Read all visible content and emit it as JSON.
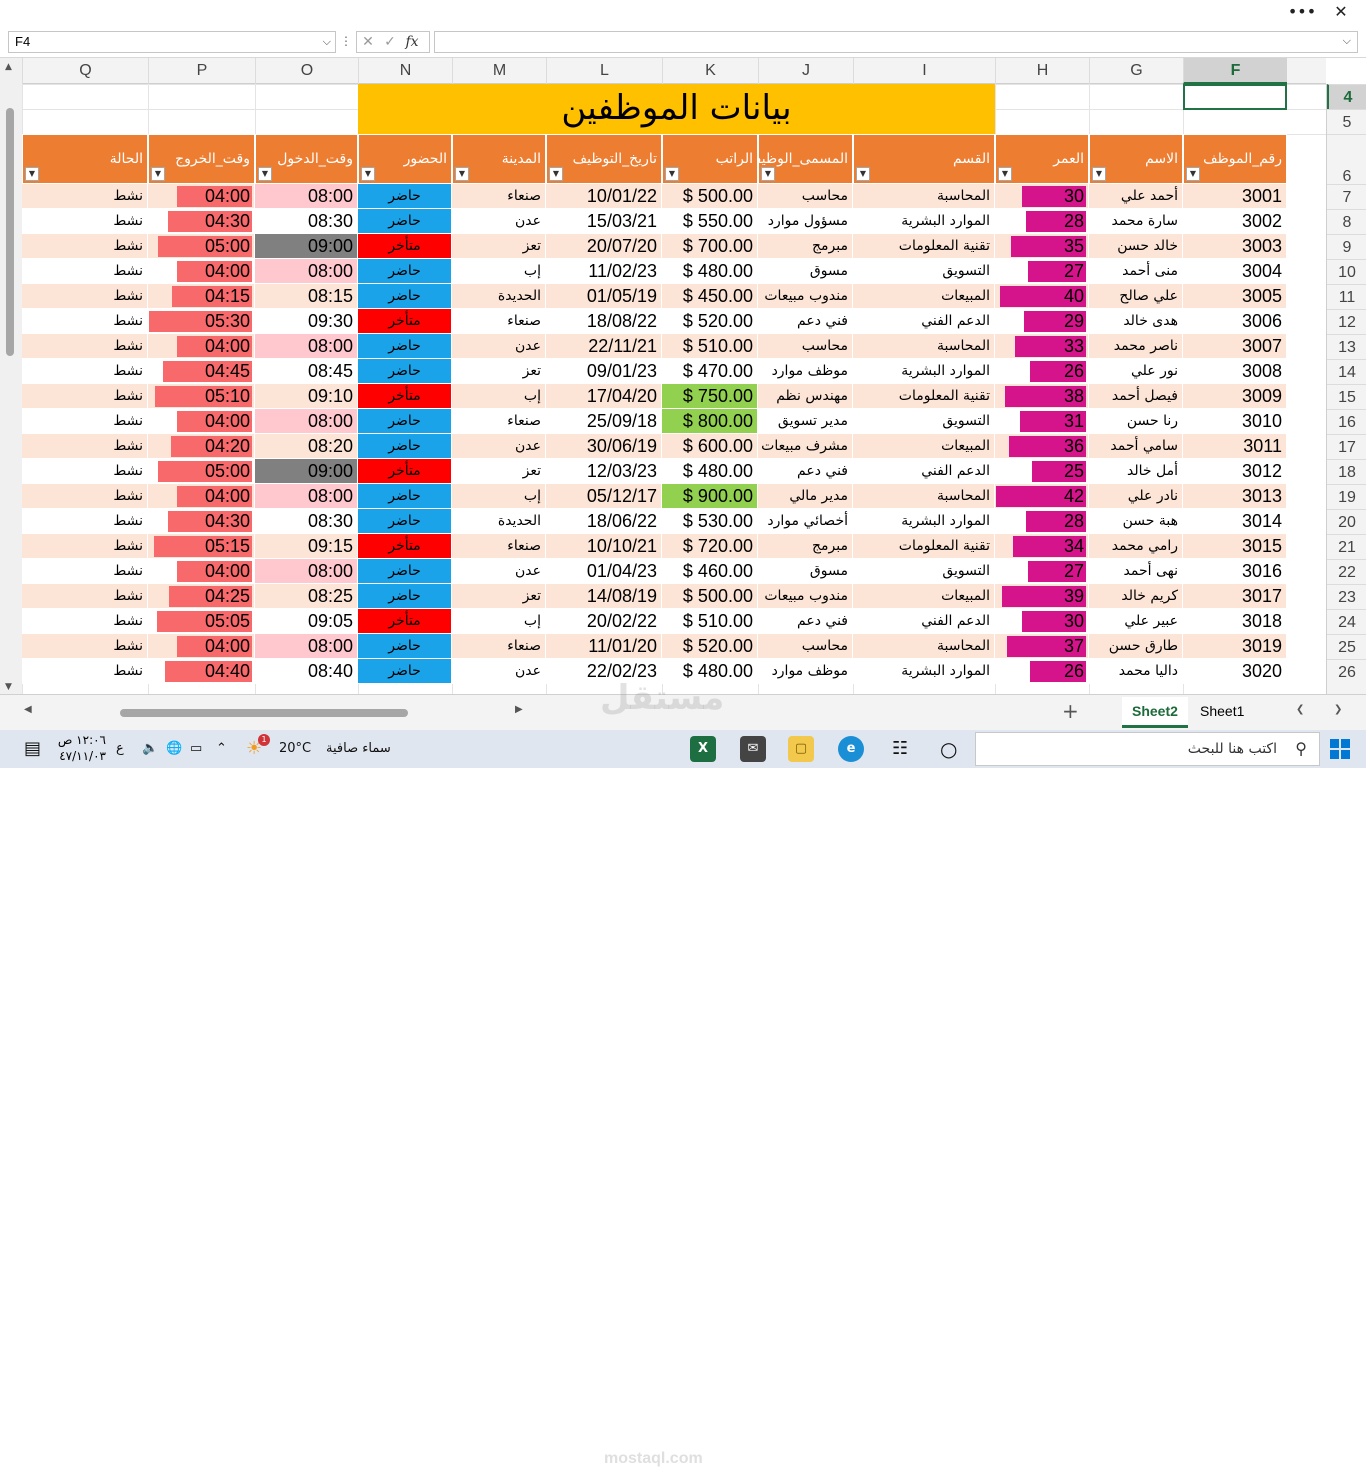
{
  "window": {
    "more_label": "•••",
    "close_label": "✕"
  },
  "formula_bar": {
    "name_box": "F4",
    "cancel_glyph": "✕",
    "enter_glyph": "✓",
    "fx_label": "fx",
    "formula": ""
  },
  "columns": [
    "Q",
    "P",
    "O",
    "N",
    "M",
    "L",
    "K",
    "J",
    "I",
    "H",
    "G",
    "F"
  ],
  "selected_column": "F",
  "row_numbers": [
    "4",
    "5",
    "6",
    "7",
    "8",
    "9",
    "10",
    "11",
    "12",
    "13",
    "14",
    "15",
    "16",
    "17",
    "18",
    "19",
    "20",
    "21",
    "22",
    "23",
    "24",
    "25",
    "26"
  ],
  "selected_row": "4",
  "sheet_title": "بيانات الموظفين",
  "headers": {
    "F": "رقم_الموظف",
    "G": "الاسم",
    "H": "العمر",
    "I": "القسم",
    "J": "المسمى_الوظيفي",
    "K": "الراتب",
    "L": "تاريخ_التوظيف",
    "M": "المدينة",
    "N": "الحضور",
    "O": "وقت_الدخول",
    "P": "وقت_الخروج",
    "Q": "الحالة"
  },
  "rows": [
    {
      "id": "3001",
      "name": "أحمد علي",
      "age": 30,
      "dept": "المحاسبة",
      "title": "محاسب",
      "salary": "$ 500.00",
      "date": "10/01/22",
      "city": "صنعاء",
      "att": "حاضر",
      "in": "08:00",
      "out": "04:00",
      "status": "نشط"
    },
    {
      "id": "3002",
      "name": "سارة محمد",
      "age": 28,
      "dept": "الموارد البشرية",
      "title": "مسؤول موارد",
      "salary": "$ 550.00",
      "date": "15/03/21",
      "city": "عدن",
      "att": "حاضر",
      "in": "08:30",
      "out": "04:30",
      "status": "نشط"
    },
    {
      "id": "3003",
      "name": "خالد حسن",
      "age": 35,
      "dept": "تقنية المعلومات",
      "title": "مبرمج",
      "salary": "$ 700.00",
      "date": "20/07/20",
      "city": "تعز",
      "att": "متأخر",
      "in": "09:00",
      "out": "05:00",
      "status": "نشط"
    },
    {
      "id": "3004",
      "name": "منى أحمد",
      "age": 27,
      "dept": "التسويق",
      "title": "مسوق",
      "salary": "$ 480.00",
      "date": "11/02/23",
      "city": "إب",
      "att": "حاضر",
      "in": "08:00",
      "out": "04:00",
      "status": "نشط"
    },
    {
      "id": "3005",
      "name": "علي صالح",
      "age": 40,
      "dept": "المبيعات",
      "title": "مندوب مبيعات",
      "salary": "$ 450.00",
      "date": "01/05/19",
      "city": "الحديدة",
      "att": "حاضر",
      "in": "08:15",
      "out": "04:15",
      "status": "نشط"
    },
    {
      "id": "3006",
      "name": "هدى خالد",
      "age": 29,
      "dept": "الدعم الفني",
      "title": "فني دعم",
      "salary": "$ 520.00",
      "date": "18/08/22",
      "city": "صنعاء",
      "att": "متأخر",
      "in": "09:30",
      "out": "05:30",
      "status": "نشط"
    },
    {
      "id": "3007",
      "name": "ناصر محمد",
      "age": 33,
      "dept": "المحاسبة",
      "title": "محاسب",
      "salary": "$ 510.00",
      "date": "22/11/21",
      "city": "عدن",
      "att": "حاضر",
      "in": "08:00",
      "out": "04:00",
      "status": "نشط"
    },
    {
      "id": "3008",
      "name": "نور علي",
      "age": 26,
      "dept": "الموارد البشرية",
      "title": "موظف موارد",
      "salary": "$ 470.00",
      "date": "09/01/23",
      "city": "تعز",
      "att": "حاضر",
      "in": "08:45",
      "out": "04:45",
      "status": "نشط"
    },
    {
      "id": "3009",
      "name": "فيصل أحمد",
      "age": 38,
      "dept": "تقنية المعلومات",
      "title": "مهندس نظم",
      "salary": "$ 750.00",
      "date": "17/04/20",
      "city": "إب",
      "att": "متأخر",
      "in": "09:10",
      "out": "05:10",
      "status": "نشط"
    },
    {
      "id": "3010",
      "name": "رنا حسن",
      "age": 31,
      "dept": "التسويق",
      "title": "مدير تسويق",
      "salary": "$ 800.00",
      "date": "25/09/18",
      "city": "صنعاء",
      "att": "حاضر",
      "in": "08:00",
      "out": "04:00",
      "status": "نشط"
    },
    {
      "id": "3011",
      "name": "سامي أحمد",
      "age": 36,
      "dept": "المبيعات",
      "title": "مشرف مبيعات",
      "salary": "$ 600.00",
      "date": "30/06/19",
      "city": "عدن",
      "att": "حاضر",
      "in": "08:20",
      "out": "04:20",
      "status": "نشط"
    },
    {
      "id": "3012",
      "name": "أمل خالد",
      "age": 25,
      "dept": "الدعم الفني",
      "title": "فني دعم",
      "salary": "$ 480.00",
      "date": "12/03/23",
      "city": "تعز",
      "att": "متأخر",
      "in": "09:00",
      "out": "05:00",
      "status": "نشط"
    },
    {
      "id": "3013",
      "name": "نادر علي",
      "age": 42,
      "dept": "المحاسبة",
      "title": "مدير مالي",
      "salary": "$ 900.00",
      "date": "05/12/17",
      "city": "إب",
      "att": "حاضر",
      "in": "08:00",
      "out": "04:00",
      "status": "نشط"
    },
    {
      "id": "3014",
      "name": "هبة حسن",
      "age": 28,
      "dept": "الموارد البشرية",
      "title": "أخصائي موارد",
      "salary": "$ 530.00",
      "date": "18/06/22",
      "city": "الحديدة",
      "att": "حاضر",
      "in": "08:30",
      "out": "04:30",
      "status": "نشط"
    },
    {
      "id": "3015",
      "name": "رامي محمد",
      "age": 34,
      "dept": "تقنية المعلومات",
      "title": "مبرمج",
      "salary": "$ 720.00",
      "date": "10/10/21",
      "city": "صنعاء",
      "att": "متأخر",
      "in": "09:15",
      "out": "05:15",
      "status": "نشط"
    },
    {
      "id": "3016",
      "name": "نهى أحمد",
      "age": 27,
      "dept": "التسويق",
      "title": "مسوق",
      "salary": "$ 460.00",
      "date": "01/04/23",
      "city": "عدن",
      "att": "حاضر",
      "in": "08:00",
      "out": "04:00",
      "status": "نشط"
    },
    {
      "id": "3017",
      "name": "كريم خالد",
      "age": 39,
      "dept": "المبيعات",
      "title": "مندوب مبيعات",
      "salary": "$ 500.00",
      "date": "14/08/19",
      "city": "تعز",
      "att": "حاضر",
      "in": "08:25",
      "out": "04:25",
      "status": "نشط"
    },
    {
      "id": "3018",
      "name": "عبير علي",
      "age": 30,
      "dept": "الدعم الفني",
      "title": "فني دعم",
      "salary": "$ 510.00",
      "date": "20/02/22",
      "city": "إب",
      "att": "متأخر",
      "in": "09:05",
      "out": "05:05",
      "status": "نشط"
    },
    {
      "id": "3019",
      "name": "طارق حسن",
      "age": 37,
      "dept": "المحاسبة",
      "title": "محاسب",
      "salary": "$ 520.00",
      "date": "11/01/20",
      "city": "صنعاء",
      "att": "حاضر",
      "in": "08:00",
      "out": "04:00",
      "status": "نشط"
    },
    {
      "id": "3020",
      "name": "داليا محمد",
      "age": 26,
      "dept": "الموارد البشرية",
      "title": "موظف موارد",
      "salary": "$ 480.00",
      "date": "22/02/23",
      "city": "عدن",
      "att": "حاضر",
      "in": "08:40",
      "out": "04:40",
      "status": "نشط"
    }
  ],
  "colors": {
    "title_bg": "#ffc000",
    "header_bg": "#ed7d31",
    "band": "#fce4d6",
    "age_bar": "#d5138a",
    "present": "#1aa3e8",
    "late": "#ff0000",
    "in_on_time": "#ffc7ce",
    "in_late": "#808080",
    "out_bar": "#f8696b",
    "salary_high": "#92d050"
  },
  "sheets": [
    {
      "label": "Sheet2",
      "active": true
    },
    {
      "label": "Sheet1",
      "active": false
    }
  ],
  "taskbar": {
    "search_placeholder": "اكتب هنا للبحث",
    "weather": "سماء صافية",
    "temperature": "20°C",
    "clock_time": "١٢:٠٦ ص",
    "clock_date": "٤٧/١١/٠٣",
    "lang": "ع",
    "notif_count": "1",
    "icons": [
      "search-icon",
      "task-view-icon",
      "edge-icon",
      "file-explorer-icon",
      "mail-icon",
      "excel-icon"
    ]
  },
  "watermark": {
    "text": "مستقل",
    "sub": "mostaql.com"
  }
}
